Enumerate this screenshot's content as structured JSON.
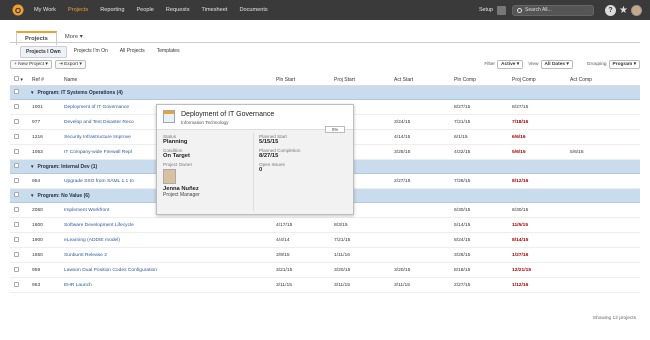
{
  "nav": {
    "items": [
      "My Work",
      "Projects",
      "Reporting",
      "People",
      "Requests",
      "Timesheet",
      "Documents"
    ],
    "active_index": 1,
    "setup": "Setup",
    "search_placeholder": "Search All...",
    "help": "?",
    "accent": "#f0a030"
  },
  "tabs": {
    "projects": "Projects",
    "more": "More"
  },
  "subtabs": [
    "Projects I Own",
    "Projects I'm On",
    "All Projects",
    "Templates"
  ],
  "toolbar": {
    "new_project": "New Project",
    "export": "Export",
    "filter_label": "Filter",
    "filter_value": "Active",
    "view_label": "View",
    "view_value": "All Dates",
    "grouping_label": "Grouping",
    "grouping_value": "Program"
  },
  "columns": [
    "Ref #",
    "Name",
    "Pln Start",
    "Proj Start",
    "Act Start",
    "Pln Comp",
    "Proj Comp",
    "Act Comp"
  ],
  "groups": [
    {
      "label": "Program: IT Systems Operations (4)",
      "rows": [
        {
          "ref": "1001",
          "name": "Deployment of IT Governance",
          "pln_start": "",
          "proj_start": "5/15/15",
          "act_start": "",
          "pln_comp": "8/27/15",
          "proj_comp": "8/27/15",
          "act_comp": "",
          "late": false
        },
        {
          "ref": "977",
          "name": "Develop and Test Disaster Reco",
          "pln_start": "",
          "proj_start": "",
          "act_start": "3/24/15",
          "pln_comp": "7/21/15",
          "proj_comp": "7/18/16",
          "act_comp": "",
          "late": true
        },
        {
          "ref": "1216",
          "name": "Security Infrastructure Improve",
          "pln_start": "",
          "proj_start": "",
          "act_start": "4/14/15",
          "pln_comp": "6/1/15",
          "proj_comp": "6/6/16",
          "act_comp": "",
          "late": true
        },
        {
          "ref": "1053",
          "name": "IT Company-wide Firewall Repl",
          "pln_start": "",
          "proj_start": "",
          "act_start": "3/25/15",
          "pln_comp": "4/22/15",
          "proj_comp": "5/6/15",
          "act_comp": "5/6/15",
          "late": true
        }
      ]
    },
    {
      "label": "Program: Internal Dev (1)",
      "rows": [
        {
          "ref": "954",
          "name": "Upgrade SSO from SAML 1.1 to",
          "pln_start": "",
          "proj_start": "2/27/15",
          "act_start": "2/27/15",
          "pln_comp": "7/28/15",
          "proj_comp": "8/12/16",
          "act_comp": "",
          "late": true
        }
      ]
    },
    {
      "label": "Program: No Value (6)",
      "rows": [
        {
          "ref": "2050",
          "name": "Implement Workfront",
          "pln_start": "4/24/15",
          "proj_start": "4/24/15",
          "act_start": "",
          "pln_comp": "6/30/15",
          "proj_comp": "6/30/15",
          "act_comp": "",
          "late": false
        },
        {
          "ref": "1600",
          "name": "Software Development Lifecycle",
          "pln_start": "4/17/15",
          "proj_start": "8/3/15",
          "act_start": "",
          "pln_comp": "5/14/15",
          "proj_comp": "11/5/15",
          "act_comp": "",
          "late": true
        },
        {
          "ref": "1900",
          "name": "eLearning (ADDIE model)",
          "pln_start": "4/4/14",
          "proj_start": "7/21/15",
          "act_start": "",
          "pln_comp": "8/24/15",
          "proj_comp": "8/14/15",
          "act_comp": "",
          "late": true
        },
        {
          "ref": "1650",
          "name": "Sunburst Release 2",
          "pln_start": "3/9/15",
          "proj_start": "1/11/16",
          "act_start": "",
          "pln_comp": "3/26/15",
          "proj_comp": "1/27/16",
          "act_comp": "",
          "late": true
        },
        {
          "ref": "959",
          "name": "Lawson Dual Position Codes Configuration",
          "pln_start": "3/21/15",
          "proj_start": "3/20/15",
          "act_start": "3/20/15",
          "pln_comp": "8/18/15",
          "proj_comp": "12/21/15",
          "act_comp": "",
          "late": true
        },
        {
          "ref": "953",
          "name": "EHR Launch",
          "pln_start": "3/11/15",
          "proj_start": "3/11/15",
          "act_start": "3/11/15",
          "pln_comp": "2/27/15",
          "proj_comp": "1/12/16",
          "act_comp": "",
          "late": true
        }
      ]
    }
  ],
  "footer": "Showing 12 projects",
  "popup": {
    "title": "Deployment of IT Governance",
    "subtitle": "Information Technology",
    "progress": "0%",
    "status_label": "Status",
    "status": "Planning",
    "condition_label": "Condition",
    "condition": "On Target",
    "owner_label": "Project Owner",
    "owner_name": "Jenna Nuñez",
    "owner_role": "Project Manager",
    "planned_start_label": "Planned Start",
    "planned_start": "5/15/15",
    "planned_completion_label": "Planned Completion",
    "planned_completion": "8/27/15",
    "open_issues_label": "Open Issues",
    "open_issues": "0"
  },
  "colors": {
    "late": "#b00000",
    "link": "#2a5a9a",
    "group_bg": "#c8dcee"
  }
}
